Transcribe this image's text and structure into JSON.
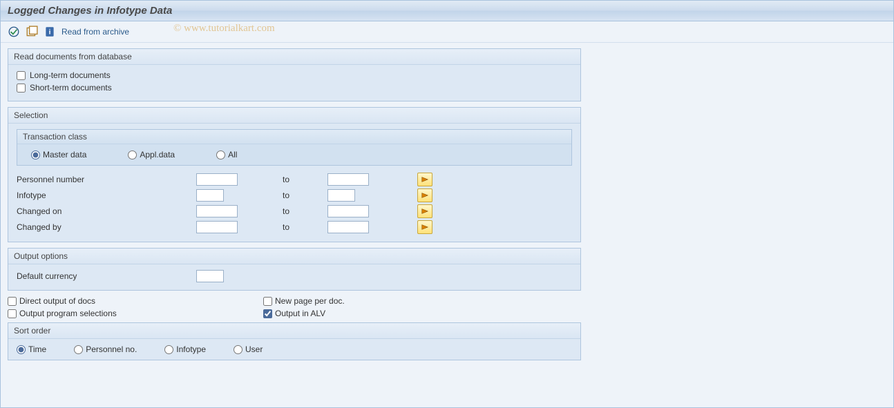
{
  "title": "Logged Changes in Infotype Data",
  "toolbar": {
    "read_from_archive": "Read from archive"
  },
  "watermark": "© www.tutorialkart.com",
  "group_read": {
    "title": "Read documents from database",
    "long_term": "Long-term documents",
    "short_term": "Short-term documents"
  },
  "group_selection": {
    "title": "Selection",
    "transaction_class": {
      "title": "Transaction class",
      "master_data": "Master data",
      "appl_data": "Appl.data",
      "all": "All"
    },
    "personnel_number": "Personnel number",
    "infotype": "Infotype",
    "changed_on": "Changed on",
    "changed_by": "Changed by",
    "to": "to"
  },
  "group_output": {
    "title": "Output options",
    "default_currency": "Default currency"
  },
  "bottom": {
    "direct_output": "Direct output of docs",
    "output_program_selections": "Output program selections",
    "new_page": "New page per doc.",
    "output_alv": "Output in ALV"
  },
  "group_sort": {
    "title": "Sort order",
    "time": "Time",
    "personnel_no": "Personnel no.",
    "infotype": "Infotype",
    "user": "User"
  }
}
